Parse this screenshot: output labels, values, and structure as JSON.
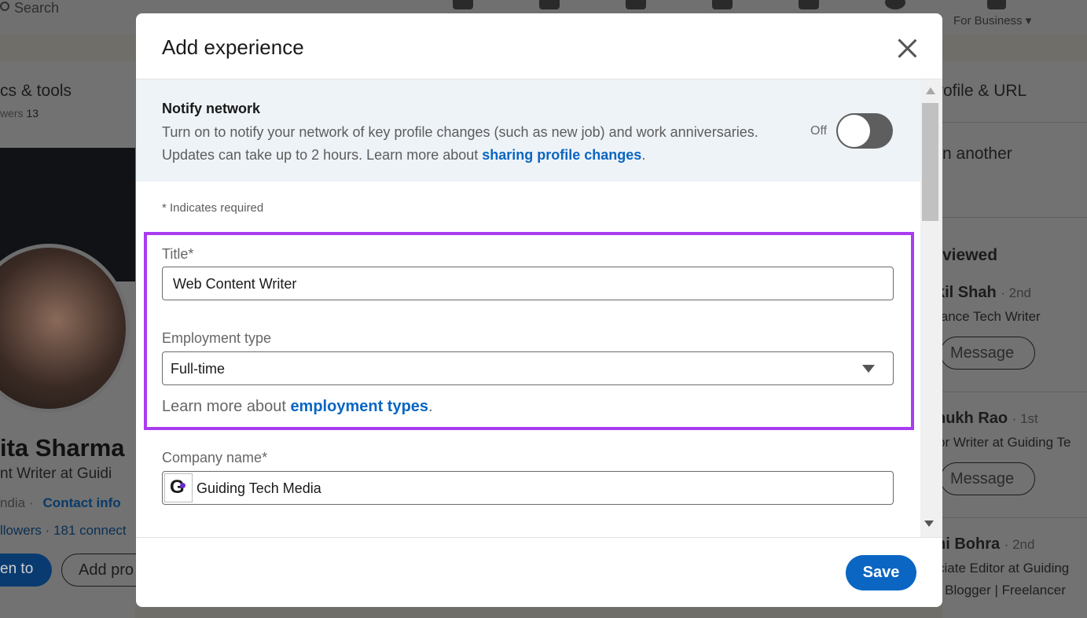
{
  "background": {
    "search_placeholder": "Search",
    "for_business": "For Business ▾",
    "left": {
      "section_title": "cs & tools",
      "followers_label": "wers",
      "followers_count": "13",
      "name": "ita Sharma",
      "headline": "nt Writer at Guidi",
      "location": "ndia ·",
      "contact_info": "Contact info",
      "followers_line": "llowers  · 181 connect",
      "open_to": "en to",
      "add_profile": "Add pro"
    },
    "right": {
      "profile_url": "rofile & URL",
      "another": "n another",
      "viewed": "viewed",
      "people": [
        {
          "name": "kil Shah",
          "degree": "· 2nd",
          "role": "lance Tech Writer",
          "button": "Message"
        },
        {
          "name": "nukh Rao",
          "degree": "· 1st",
          "role": "or Writer at Guiding Te",
          "button": "Message"
        },
        {
          "name": "hi Bohra",
          "degree": "· 2nd",
          "role": "ciate Editor at Guiding",
          "role2": "| Blogger | Freelancer"
        }
      ]
    }
  },
  "modal": {
    "title": "Add experience",
    "close_icon": "close-icon",
    "notify": {
      "title": "Notify network",
      "description": "Turn on to notify your network of key profile changes (such as new job) and work anniversaries. Updates can take up to 2 hours. Learn more about ",
      "link": "sharing profile changes",
      "trailing": ".",
      "toggle_label": "Off",
      "toggle_on": false
    },
    "required_note": "* Indicates required",
    "highlight_color": "#a93cf0",
    "title_field": {
      "label": "Title*",
      "value": "Web Content Writer"
    },
    "employment_type": {
      "label": "Employment type",
      "value": "Full-time",
      "learn_more_prefix": "Learn more about ",
      "learn_more_link": "employment types",
      "learn_more_suffix": "."
    },
    "company": {
      "label": "Company name*",
      "value": "Guiding Tech Media",
      "logo_letter": "G"
    },
    "save_label": "Save",
    "accent_color": "#0a66c2"
  }
}
